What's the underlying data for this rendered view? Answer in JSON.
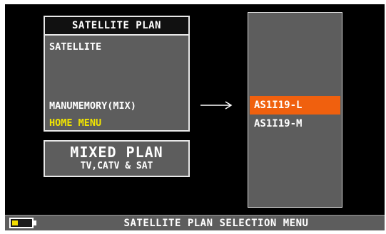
{
  "menu": {
    "title": "SATELLITE PLAN",
    "items": [
      {
        "label": "SATELLITE"
      },
      {
        "label": "MANUMEMORY(MIX)"
      },
      {
        "label": "HOME MENU"
      }
    ]
  },
  "mixed_plan": {
    "title": "MIXED PLAN",
    "subtitle": "TV,CATV & SAT"
  },
  "plan_list": {
    "items": [
      {
        "label": "AS1I19-L",
        "selected": true
      },
      {
        "label": "AS1I19-M",
        "selected": false
      }
    ]
  },
  "status_bar": {
    "title": "SATELLITE PLAN SELECTION MENU",
    "battery_level": 0.3
  },
  "colors": {
    "selection": "#f0600e",
    "highlight_text": "#f2e600",
    "panel": "#5d5d5d",
    "screen": "#000000"
  },
  "icons": [
    "battery-icon",
    "right-arrow-icon"
  ]
}
